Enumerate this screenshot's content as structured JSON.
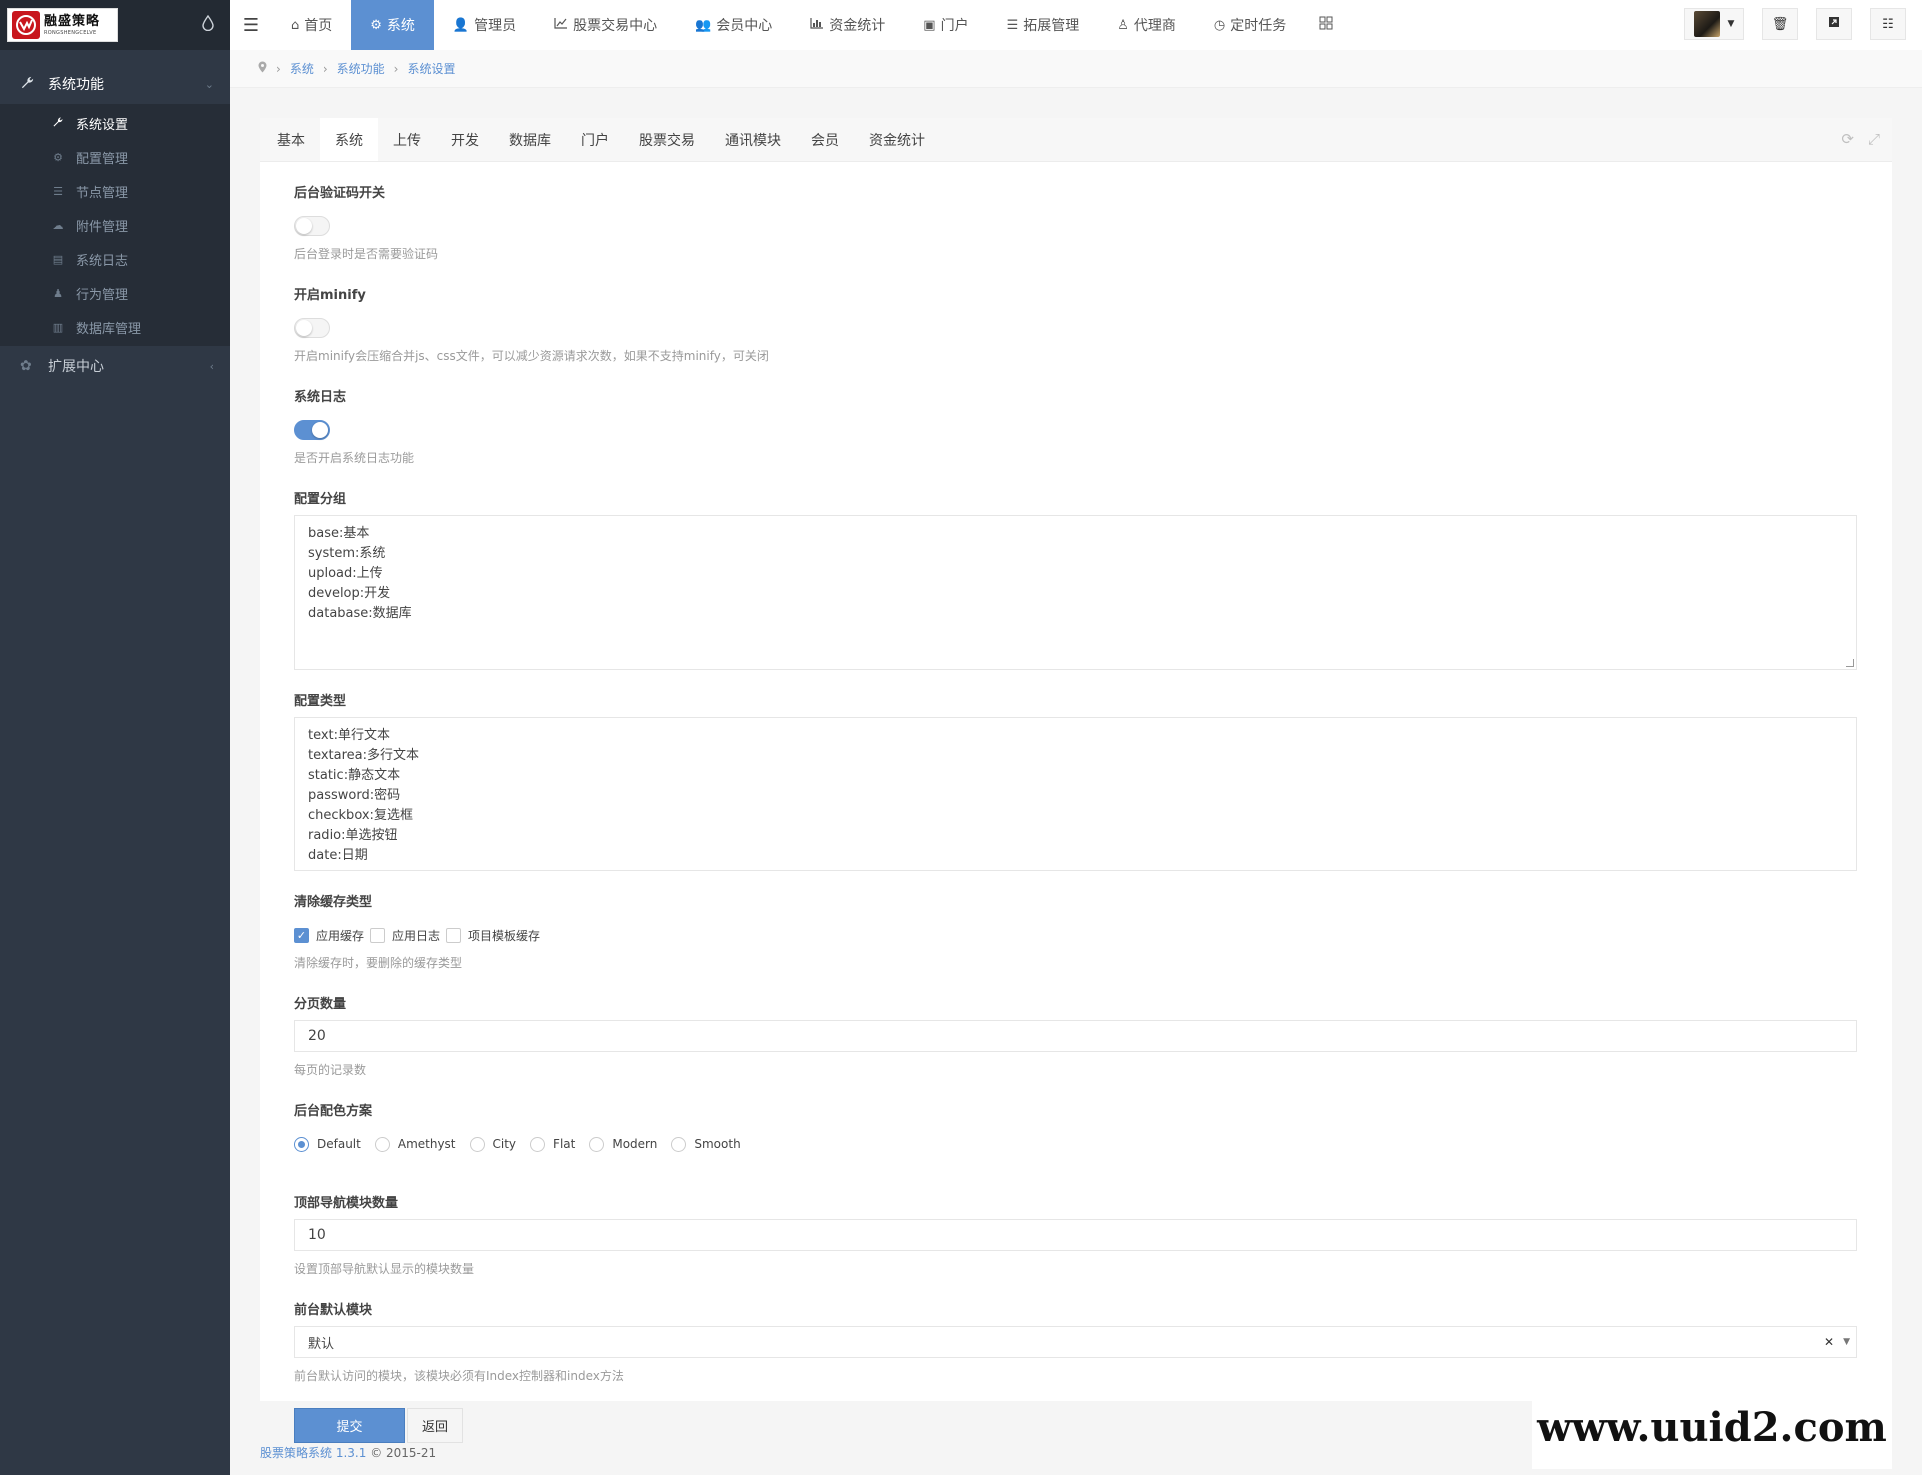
{
  "brand": {
    "logo_cn": "融盛策略",
    "logo_en": "RONGSHENGCELVE",
    "accent": "#5c90d2"
  },
  "sidebar": {
    "groups": [
      {
        "label": "系统功能",
        "icon": "wrench-icon"
      },
      {
        "label": "扩展中心",
        "icon": "gear-cluster-icon"
      }
    ],
    "items": [
      {
        "label": "系统设置",
        "icon": "wrench-icon"
      },
      {
        "label": "配置管理",
        "icon": "cogs-icon"
      },
      {
        "label": "节点管理",
        "icon": "list-icon"
      },
      {
        "label": "附件管理",
        "icon": "cloud-icon"
      },
      {
        "label": "系统日志",
        "icon": "book-icon"
      },
      {
        "label": "行为管理",
        "icon": "user-secret-icon"
      },
      {
        "label": "数据库管理",
        "icon": "database-icon"
      }
    ]
  },
  "topnav": {
    "items": [
      {
        "label": "首页",
        "icon": "home-icon"
      },
      {
        "label": "系统",
        "icon": "gear-icon"
      },
      {
        "label": "管理员",
        "icon": "user-icon"
      },
      {
        "label": "股票交易中心",
        "icon": "line-chart-icon"
      },
      {
        "label": "会员中心",
        "icon": "users-icon"
      },
      {
        "label": "资金统计",
        "icon": "bar-chart-icon"
      },
      {
        "label": "门户",
        "icon": "newspaper-icon"
      },
      {
        "label": "拓展管理",
        "icon": "list-icon"
      },
      {
        "label": "代理商",
        "icon": "male-icon"
      },
      {
        "label": "定时任务",
        "icon": "clock-icon"
      }
    ]
  },
  "breadcrumb": [
    "系统",
    "系统功能",
    "系统设置"
  ],
  "tabs": [
    "基本",
    "系统",
    "上传",
    "开发",
    "数据库",
    "门户",
    "股票交易",
    "通讯模块",
    "会员",
    "资金统计"
  ],
  "form": {
    "captcha": {
      "label": "后台验证码开关",
      "help": "后台登录时是否需要验证码",
      "on": false
    },
    "minify": {
      "label": "开启minify",
      "help": "开启minify会压缩合并js、css文件，可以减少资源请求次数，如果不支持minify，可关闭",
      "on": false
    },
    "syslog": {
      "label": "系统日志",
      "help": "是否开启系统日志功能",
      "on": true
    },
    "config_group": {
      "label": "配置分组",
      "lines": [
        "base:基本",
        "system:系统",
        "upload:上传",
        "develop:开发",
        "database:数据库"
      ]
    },
    "config_type": {
      "label": "配置类型",
      "lines": [
        "text:单行文本",
        "textarea:多行文本",
        "static:静态文本",
        "password:密码",
        "checkbox:复选框",
        "radio:单选按钮",
        "date:日期"
      ]
    },
    "cache_types": {
      "label": "清除缓存类型",
      "help": "清除缓存时，要删除的缓存类型",
      "options": [
        {
          "label": "应用缓存",
          "checked": true
        },
        {
          "label": "应用日志",
          "checked": false
        },
        {
          "label": "项目模板缓存",
          "checked": false
        }
      ]
    },
    "page_size": {
      "label": "分页数量",
      "value": "20",
      "help": "每页的记录数"
    },
    "color_scheme": {
      "label": "后台配色方案",
      "options": [
        "Default",
        "Amethyst",
        "City",
        "Flat",
        "Modern",
        "Smooth"
      ],
      "selected": "Default"
    },
    "topnav_count": {
      "label": "顶部导航模块数量",
      "value": "10",
      "help": "设置顶部导航默认显示的模块数量"
    },
    "default_module": {
      "label": "前台默认模块",
      "value": "默认",
      "help": "前台默认访问的模块，该模块必须有Index控制器和index方法"
    },
    "submit_label": "提交",
    "back_label": "返回"
  },
  "footer": {
    "brand": "股票策略系统 1.3.1",
    "copyright": "© 2015-21"
  },
  "watermark": "www.uuid2.com"
}
